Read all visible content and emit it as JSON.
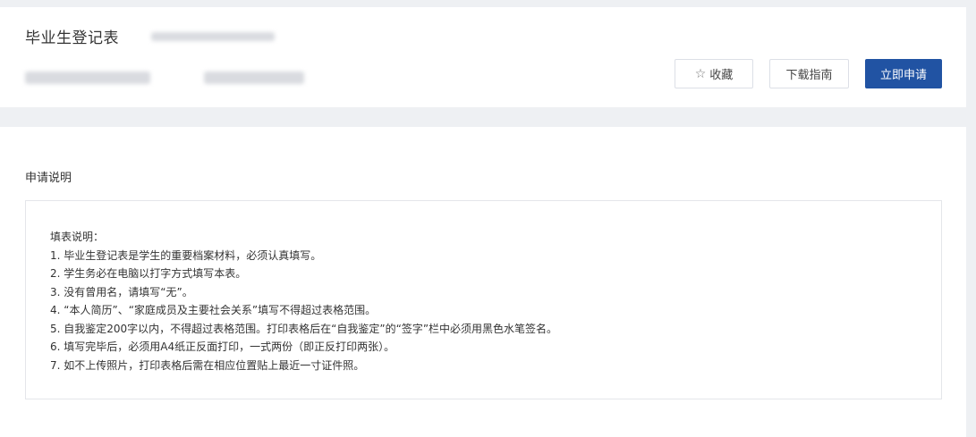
{
  "header": {
    "title": "毕业生登记表",
    "favorite_label": "收藏",
    "favorite_icon": "star-outline-icon",
    "guide_label": "下载指南",
    "apply_label": "立即申请",
    "accent_color": "#2153a3"
  },
  "main": {
    "section_title": "申请说明",
    "notes_heading": "填表说明：",
    "notes": [
      "1. 毕业生登记表是学生的重要档案材料，必须认真填写。",
      "2. 学生务必在电脑以打字方式填写本表。",
      "3. 没有曾用名，请填写“无”。",
      "4. “本人简历”、“家庭成员及主要社会关系”填写不得超过表格范围。",
      "5. 自我鉴定200字以内，不得超过表格范围。打印表格后在“自我鉴定”的“签字”栏中必须用黑色水笔签名。",
      "6. 填写完毕后，必须用A4纸正反面打印，一式两份（即正反打印两张）。",
      "7. 如不上传照片，打印表格后需在相应位置贴上最近一寸证件照。"
    ]
  }
}
